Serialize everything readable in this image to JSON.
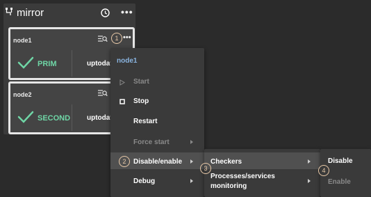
{
  "panel": {
    "title": "mirror"
  },
  "nodes": [
    {
      "name": "node1",
      "role": "PRIM",
      "state": "uptodate"
    },
    {
      "name": "node2",
      "role": "SECOND",
      "state": "uptodate"
    }
  ],
  "badges": [
    "1",
    "2",
    "3",
    "4"
  ],
  "context_menu": {
    "header": "node1",
    "items": [
      {
        "label": "Start",
        "enabled": false
      },
      {
        "label": "Stop",
        "enabled": true
      },
      {
        "label": "Restart",
        "enabled": true
      },
      {
        "label": "Force start",
        "enabled": false
      },
      {
        "label": "Disable/enable",
        "enabled": true
      },
      {
        "label": "Debug",
        "enabled": true
      }
    ]
  },
  "submenu": {
    "items": [
      {
        "label": "Checkers"
      },
      {
        "label": "Processes/services",
        "label2": "monitoring"
      }
    ]
  },
  "submenu2": {
    "items": [
      {
        "label": "Disable",
        "enabled": true
      },
      {
        "label": "Enable",
        "enabled": false
      }
    ]
  },
  "colors": {
    "accent_green": "#6fd6a6",
    "header_blue": "#8ab4e0",
    "badge": "#e8c9a8"
  }
}
